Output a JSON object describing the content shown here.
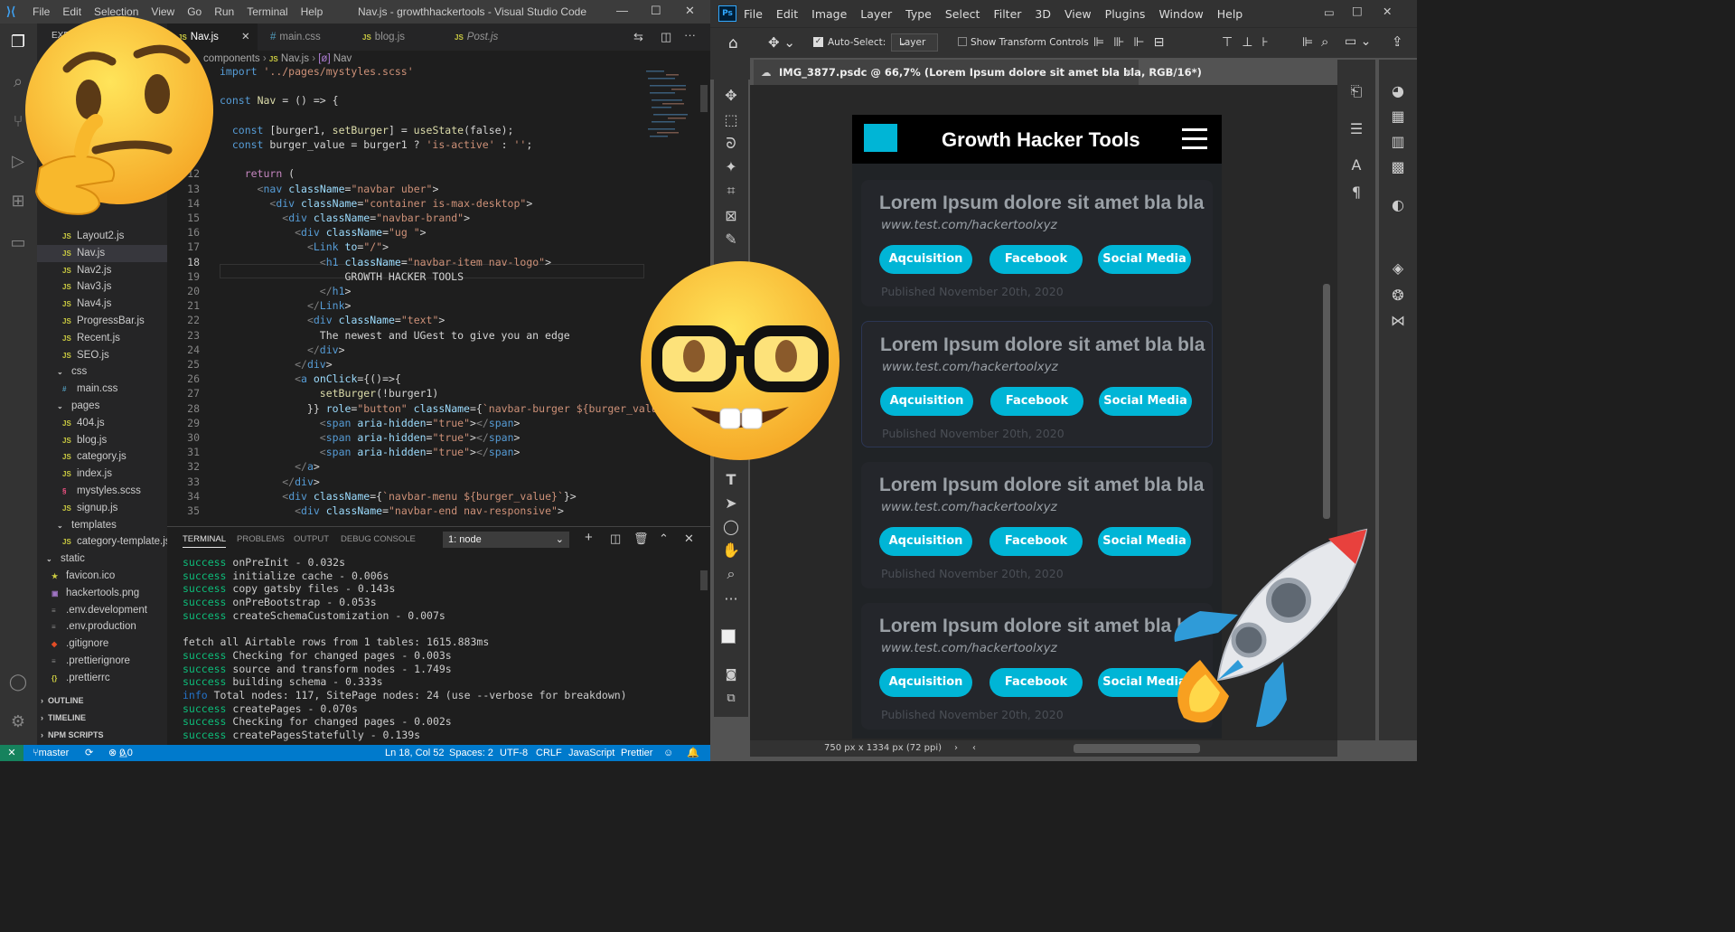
{
  "vscode": {
    "title": "Nav.js - growthhackertools - Visual Studio Code",
    "menu": [
      "File",
      "Edit",
      "Selection",
      "View",
      "Go",
      "Run",
      "Terminal",
      "Help"
    ],
    "tabs": [
      {
        "label": "Nav.js",
        "type": "js"
      },
      {
        "label": "main.css",
        "type": "css"
      },
      {
        "label": "blog.js",
        "type": "js"
      },
      {
        "label": "Post.js",
        "type": "js"
      }
    ],
    "breadcrumb": [
      "components",
      "Nav.js",
      "Nav"
    ],
    "explorer_label": "EXP",
    "tree": [
      {
        "label": "Layout2.js",
        "type": "js"
      },
      {
        "label": "Nav.js",
        "type": "js"
      },
      {
        "label": "Nav2.js",
        "type": "js"
      },
      {
        "label": "Nav3.js",
        "type": "js"
      },
      {
        "label": "Nav4.js",
        "type": "js"
      },
      {
        "label": "ProgressBar.js",
        "type": "js"
      },
      {
        "label": "Recent.js",
        "type": "js"
      },
      {
        "label": "SEO.js",
        "type": "js"
      },
      {
        "label": "css",
        "type": "folder"
      },
      {
        "label": "main.css",
        "type": "css"
      },
      {
        "label": "pages",
        "type": "folder"
      },
      {
        "label": "404.js",
        "type": "js"
      },
      {
        "label": "blog.js",
        "type": "js"
      },
      {
        "label": "category.js",
        "type": "js"
      },
      {
        "label": "index.js",
        "type": "js"
      },
      {
        "label": "mystyles.scss",
        "type": "scss"
      },
      {
        "label": "signup.js",
        "type": "js"
      },
      {
        "label": "templates",
        "type": "folder"
      },
      {
        "label": "category-template.js",
        "type": "js"
      },
      {
        "label": "static",
        "type": "folder"
      },
      {
        "label": "favicon.ico",
        "type": "ico"
      },
      {
        "label": "hackertools.png",
        "type": "png"
      },
      {
        "label": ".env.development",
        "type": "env"
      },
      {
        "label": ".env.production",
        "type": "env"
      },
      {
        "label": ".gitignore",
        "type": "git"
      },
      {
        "label": ".prettierignore",
        "type": "env"
      },
      {
        "label": ".prettierrc",
        "type": "json"
      }
    ],
    "sections": [
      "OUTLINE",
      "TIMELINE",
      "NPM SCRIPTS"
    ],
    "code_lines": [
      {
        "n": "",
        "t": "import '../pages/mystyles.scss'"
      },
      {
        "n": "",
        "t": ""
      },
      {
        "n": "",
        "t": "const Nav = () => {"
      },
      {
        "n": "",
        "t": ""
      },
      {
        "n": "",
        "t": "  const [burger1, setBurger] = useState(false);"
      },
      {
        "n": "",
        "t": "  const burger_value = burger1 ? 'is-active' : '';"
      },
      {
        "n": "",
        "t": ""
      },
      {
        "n": "12",
        "t": "    return ("
      },
      {
        "n": "13",
        "t": "      <nav className=\"navbar uber\">"
      },
      {
        "n": "14",
        "t": "        <div className=\"container is-max-desktop\">"
      },
      {
        "n": "15",
        "t": "          <div className=\"navbar-brand\">"
      },
      {
        "n": "16",
        "t": "            <div className=\"ug \">"
      },
      {
        "n": "17",
        "t": "              <Link to=\"/\">"
      },
      {
        "n": "18",
        "t": "                <h1 className=\"navbar-item nav-logo\">"
      },
      {
        "n": "19",
        "t": "                    GROWTH HACKER TOOLS"
      },
      {
        "n": "20",
        "t": "                </h1>"
      },
      {
        "n": "21",
        "t": "              </Link>"
      },
      {
        "n": "22",
        "t": "              <div className=\"text\">"
      },
      {
        "n": "23",
        "t": "                The newest and UGest to give you an edge"
      },
      {
        "n": "24",
        "t": "              </div>"
      },
      {
        "n": "25",
        "t": "            </div>"
      },
      {
        "n": "26",
        "t": "            <a onClick={()=>{"
      },
      {
        "n": "27",
        "t": "                setBurger(!burger1)"
      },
      {
        "n": "28",
        "t": "              }} role=\"button\" className={`navbar-burger ${burger_value"
      },
      {
        "n": "29",
        "t": "                <span aria-hidden=\"true\"></span>"
      },
      {
        "n": "30",
        "t": "                <span aria-hidden=\"true\"></span>"
      },
      {
        "n": "31",
        "t": "                <span aria-hidden=\"true\"></span>"
      },
      {
        "n": "32",
        "t": "            </a>"
      },
      {
        "n": "33",
        "t": "          </div>"
      },
      {
        "n": "34",
        "t": "          <div className={`navbar-menu ${burger_value}`}>"
      },
      {
        "n": "35",
        "t": "            <div className=\"navbar-end nav-responsive\">"
      }
    ],
    "panel_tabs": [
      "TERMINAL",
      "PROBLEMS",
      "OUTPUT",
      "DEBUG CONSOLE"
    ],
    "terminal_select": "1: node",
    "terminal": [
      {
        "k": "success",
        "t": " onPreInit - 0.032s"
      },
      {
        "k": "success",
        "t": " initialize cache - 0.006s"
      },
      {
        "k": "success",
        "t": " copy gatsby files - 0.143s"
      },
      {
        "k": "success",
        "t": " onPreBootstrap - 0.053s"
      },
      {
        "k": "success",
        "t": " createSchemaCustomization - 0.007s"
      },
      {
        "k": "",
        "t": ""
      },
      {
        "k": "",
        "t": "fetch all Airtable rows from 1 tables: 1615.883ms"
      },
      {
        "k": "success",
        "t": " Checking for changed pages - 0.003s"
      },
      {
        "k": "success",
        "t": " source and transform nodes - 1.749s"
      },
      {
        "k": "success",
        "t": " building schema - 0.333s"
      },
      {
        "k": "info",
        "t": " Total nodes: 117, SitePage nodes: 24 (use --verbose for breakdown)"
      },
      {
        "k": "success",
        "t": " createPages - 0.070s"
      },
      {
        "k": "success",
        "t": " Checking for changed pages - 0.002s"
      },
      {
        "k": "success",
        "t": " createPagesStatefully - 0.139s"
      }
    ],
    "status": {
      "branch": "master",
      "problems": "0",
      "warnings": "0",
      "position": "Ln 18, Col 52",
      "spaces": "Spaces: 2",
      "encoding": "UTF-8",
      "eol": "CRLF",
      "language": "JavaScript",
      "formatter": "Prettier"
    }
  },
  "photoshop": {
    "logo": "Ps",
    "menu": [
      "File",
      "Edit",
      "Image",
      "Layer",
      "Type",
      "Select",
      "Filter",
      "3D",
      "View",
      "Plugins",
      "Window",
      "Help"
    ],
    "auto_select_label": "Auto-Select:",
    "auto_select_value": "Layer",
    "transform_label": "Show Transform Controls",
    "doc_tab": "IMG_3877.psdc @ 66,7% (Lorem Ipsum dolore sit amet bla bla, RGB/16*)",
    "status": "750 px x 1334 px (72 ppi)",
    "mockup": {
      "title": "Growth Hacker Tools",
      "cards": [
        {
          "title": "Lorem Ipsum dolore sit amet bla bla",
          "url": "www.test.com/hackertoolxyz",
          "buttons": [
            "Aqcuisition",
            "Facebook",
            "Social Media"
          ],
          "date": "Published November 20th, 2020"
        },
        {
          "title": "Lorem Ipsum dolore sit amet bla bla",
          "url": "www.test.com/hackertoolxyz",
          "buttons": [
            "Aqcuisition",
            "Facebook",
            "Social Media"
          ],
          "date": "Published November 20th, 2020"
        },
        {
          "title": "Lorem Ipsum dolore sit amet bla bla",
          "url": "www.test.com/hackertoolxyz",
          "buttons": [
            "Aqcuisition",
            "Facebook",
            "Social Media"
          ],
          "date": "Published November 20th, 2020"
        },
        {
          "title": "Lorem Ipsum dolore sit amet bla bla",
          "url": "www.test.com/hackertoolxyz",
          "buttons": [
            "Aqcuisition",
            "Facebook",
            "Social Media"
          ],
          "date": "Published November 20th, 2020"
        }
      ]
    }
  },
  "colors": {
    "vscode_bg": "#1e1e1e",
    "status_bar": "#007acc",
    "ps_bg": "#535353",
    "accent_button": "#00b5d6"
  },
  "emojis": [
    "thinking-face",
    "nerd-face",
    "rocket"
  ]
}
